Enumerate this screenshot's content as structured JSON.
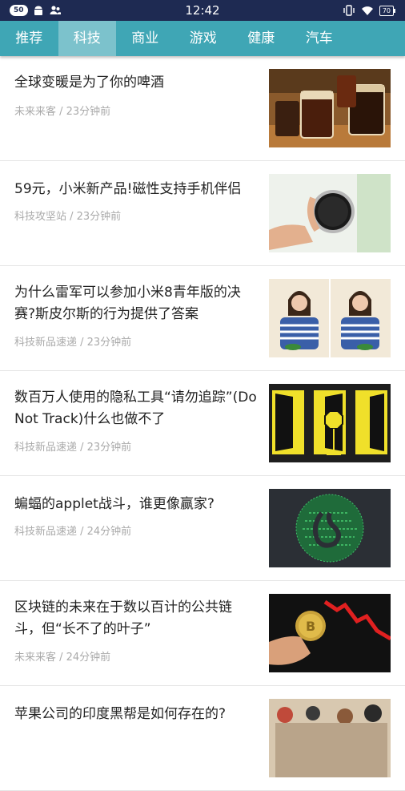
{
  "status": {
    "badge": "50",
    "time": "12:42",
    "battery": "70",
    "icons": [
      "android-icon",
      "users-icon",
      "vibrate-icon",
      "wifi-icon",
      "battery-icon"
    ]
  },
  "tabs": [
    {
      "label": "推荐",
      "active": false
    },
    {
      "label": "科技",
      "active": true
    },
    {
      "label": "商业",
      "active": false
    },
    {
      "label": "游戏",
      "active": false
    },
    {
      "label": "健康",
      "active": false
    },
    {
      "label": "汽车",
      "active": false
    }
  ],
  "articles": [
    {
      "title": "全球变暖是为了你的啤酒",
      "source": "未来来客 / 23分钟前",
      "image": "beer-glasses"
    },
    {
      "title": "59元，小米新产品!磁性支持手机伴侣",
      "source": "科技攻坚站 / 23分钟前",
      "image": "magnetic-device"
    },
    {
      "title": "为什么雷军可以参加小米8青年版的决赛?斯皮尔斯的行为提供了答案",
      "source": "科技新品速递 / 23分钟前",
      "image": "woman-photos"
    },
    {
      "title": "数百万人使用的隐私工具“请勿追踪”(Do Not Track)什么也做不了",
      "source": "科技新品速递 / 23分钟前",
      "image": "open-doors"
    },
    {
      "title": "蝙蝠的applet战斗，谁更像赢家?",
      "source": "科技新品速递 / 24分钟前",
      "image": "code-globe"
    },
    {
      "title": "区块链的未来在于数以百计的公共链斗，但“长不了的叶子”",
      "source": "未来来客 / 24分钟前",
      "image": "bitcoin-hand"
    },
    {
      "title": "苹果公司的印度黑帮是如何存在的?",
      "source": "",
      "image": "store-crowd"
    }
  ],
  "colors": {
    "status_bar": "#1e2a52",
    "tab_bar": "#3fa6b5",
    "tab_active": "#7cc2cc"
  }
}
